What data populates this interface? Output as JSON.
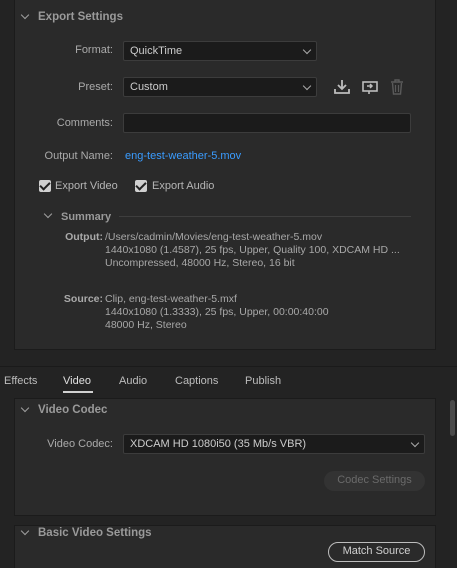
{
  "export_settings": {
    "title": "Export Settings",
    "format_label": "Format:",
    "format_value": "QuickTime",
    "preset_label": "Preset:",
    "preset_value": "Custom",
    "comments_label": "Comments:",
    "comments_value": "",
    "output_name_label": "Output Name:",
    "output_name_value": "eng-test-weather-5.mov",
    "export_video_label": "Export Video",
    "export_video_checked": true,
    "export_audio_label": "Export Audio",
    "export_audio_checked": true,
    "icons": [
      "save-preset-icon",
      "import-preset-icon",
      "delete-preset-icon"
    ]
  },
  "summary": {
    "title": "Summary",
    "output_label": "Output:",
    "output_lines": [
      "/Users/cadmin/Movies/eng-test-weather-5.mov",
      "1440x1080 (1.4587), 25 fps, Upper, Quality 100, XDCAM HD ...",
      "Uncompressed, 48000 Hz, Stereo, 16 bit"
    ],
    "source_label": "Source:",
    "source_lines": [
      "Clip, eng-test-weather-5.mxf",
      "1440x1080 (1.3333), 25 fps, Upper, 00:00:40:00",
      "48000 Hz, Stereo"
    ]
  },
  "tabs": {
    "effects": "Effects",
    "video": "Video",
    "audio": "Audio",
    "captions": "Captions",
    "publish": "Publish",
    "active": "Video"
  },
  "video_codec": {
    "title": "Video Codec",
    "codec_label": "Video Codec:",
    "codec_value": "XDCAM HD 1080i50 (35 Mb/s VBR)",
    "codec_settings_button": "Codec Settings"
  },
  "basic_video": {
    "title": "Basic Video Settings",
    "match_source_button": "Match Source"
  },
  "colors": {
    "background": "#232323",
    "panel": "#2a2a2a",
    "link": "#3a9cff",
    "active_tab_underline": "#d0d0d0"
  }
}
